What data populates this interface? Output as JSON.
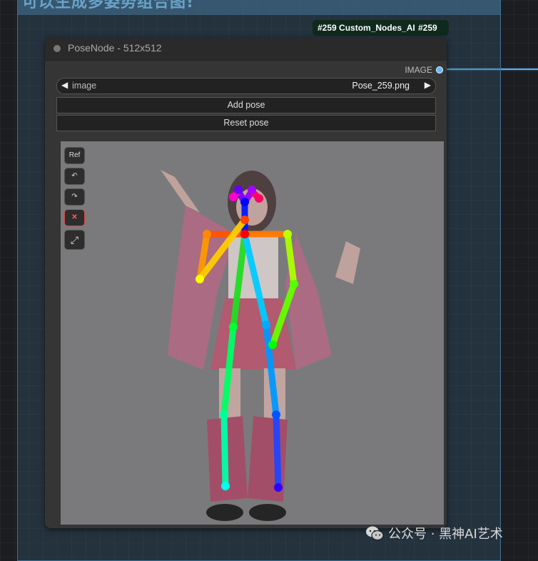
{
  "group": {
    "title": "可以生成多姿势组合图!"
  },
  "badges": {
    "node_type": "#259 Custom_Nodes_AI",
    "node_id": "#259"
  },
  "node": {
    "title": "PoseNode - 512x512",
    "output_label": "IMAGE",
    "image_combo": {
      "label": "image",
      "value": "Pose_259.png",
      "left_arrow": "◀",
      "right_arrow": "▶"
    },
    "add_pose_label": "Add pose",
    "reset_pose_label": "Reset pose",
    "tools": {
      "ref": "Ref",
      "undo": "↶",
      "redo": "↷",
      "remove": "✕",
      "expand": "⤢"
    }
  },
  "colors": {
    "link": "#5aa9e6",
    "group_fill": "#2f5573",
    "node_bg": "#353535",
    "canvas_bg": "#7a7a7d"
  },
  "watermark": {
    "text": "公众号 · 黑神AI艺术",
    "icon": "wechat-icon"
  }
}
